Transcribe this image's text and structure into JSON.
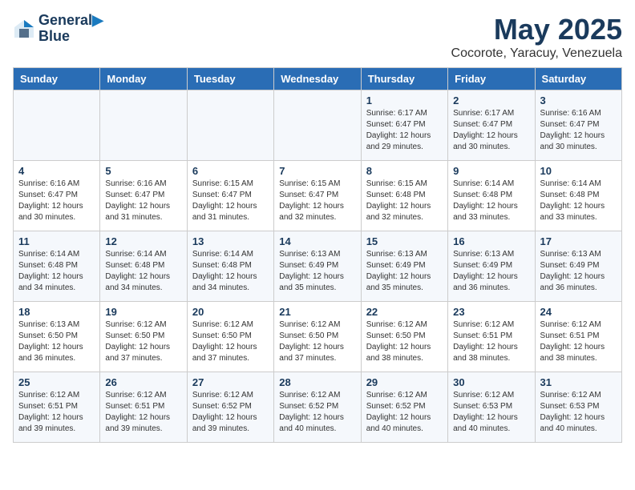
{
  "header": {
    "logo_line1": "General",
    "logo_line2": "Blue",
    "month_year": "May 2025",
    "location": "Cocorote, Yaracuy, Venezuela"
  },
  "days_of_week": [
    "Sunday",
    "Monday",
    "Tuesday",
    "Wednesday",
    "Thursday",
    "Friday",
    "Saturday"
  ],
  "weeks": [
    [
      {
        "day": "",
        "info": ""
      },
      {
        "day": "",
        "info": ""
      },
      {
        "day": "",
        "info": ""
      },
      {
        "day": "",
        "info": ""
      },
      {
        "day": "1",
        "info": "Sunrise: 6:17 AM\nSunset: 6:47 PM\nDaylight: 12 hours\nand 29 minutes."
      },
      {
        "day": "2",
        "info": "Sunrise: 6:17 AM\nSunset: 6:47 PM\nDaylight: 12 hours\nand 30 minutes."
      },
      {
        "day": "3",
        "info": "Sunrise: 6:16 AM\nSunset: 6:47 PM\nDaylight: 12 hours\nand 30 minutes."
      }
    ],
    [
      {
        "day": "4",
        "info": "Sunrise: 6:16 AM\nSunset: 6:47 PM\nDaylight: 12 hours\nand 30 minutes."
      },
      {
        "day": "5",
        "info": "Sunrise: 6:16 AM\nSunset: 6:47 PM\nDaylight: 12 hours\nand 31 minutes."
      },
      {
        "day": "6",
        "info": "Sunrise: 6:15 AM\nSunset: 6:47 PM\nDaylight: 12 hours\nand 31 minutes."
      },
      {
        "day": "7",
        "info": "Sunrise: 6:15 AM\nSunset: 6:47 PM\nDaylight: 12 hours\nand 32 minutes."
      },
      {
        "day": "8",
        "info": "Sunrise: 6:15 AM\nSunset: 6:48 PM\nDaylight: 12 hours\nand 32 minutes."
      },
      {
        "day": "9",
        "info": "Sunrise: 6:14 AM\nSunset: 6:48 PM\nDaylight: 12 hours\nand 33 minutes."
      },
      {
        "day": "10",
        "info": "Sunrise: 6:14 AM\nSunset: 6:48 PM\nDaylight: 12 hours\nand 33 minutes."
      }
    ],
    [
      {
        "day": "11",
        "info": "Sunrise: 6:14 AM\nSunset: 6:48 PM\nDaylight: 12 hours\nand 34 minutes."
      },
      {
        "day": "12",
        "info": "Sunrise: 6:14 AM\nSunset: 6:48 PM\nDaylight: 12 hours\nand 34 minutes."
      },
      {
        "day": "13",
        "info": "Sunrise: 6:14 AM\nSunset: 6:48 PM\nDaylight: 12 hours\nand 34 minutes."
      },
      {
        "day": "14",
        "info": "Sunrise: 6:13 AM\nSunset: 6:49 PM\nDaylight: 12 hours\nand 35 minutes."
      },
      {
        "day": "15",
        "info": "Sunrise: 6:13 AM\nSunset: 6:49 PM\nDaylight: 12 hours\nand 35 minutes."
      },
      {
        "day": "16",
        "info": "Sunrise: 6:13 AM\nSunset: 6:49 PM\nDaylight: 12 hours\nand 36 minutes."
      },
      {
        "day": "17",
        "info": "Sunrise: 6:13 AM\nSunset: 6:49 PM\nDaylight: 12 hours\nand 36 minutes."
      }
    ],
    [
      {
        "day": "18",
        "info": "Sunrise: 6:13 AM\nSunset: 6:50 PM\nDaylight: 12 hours\nand 36 minutes."
      },
      {
        "day": "19",
        "info": "Sunrise: 6:12 AM\nSunset: 6:50 PM\nDaylight: 12 hours\nand 37 minutes."
      },
      {
        "day": "20",
        "info": "Sunrise: 6:12 AM\nSunset: 6:50 PM\nDaylight: 12 hours\nand 37 minutes."
      },
      {
        "day": "21",
        "info": "Sunrise: 6:12 AM\nSunset: 6:50 PM\nDaylight: 12 hours\nand 37 minutes."
      },
      {
        "day": "22",
        "info": "Sunrise: 6:12 AM\nSunset: 6:50 PM\nDaylight: 12 hours\nand 38 minutes."
      },
      {
        "day": "23",
        "info": "Sunrise: 6:12 AM\nSunset: 6:51 PM\nDaylight: 12 hours\nand 38 minutes."
      },
      {
        "day": "24",
        "info": "Sunrise: 6:12 AM\nSunset: 6:51 PM\nDaylight: 12 hours\nand 38 minutes."
      }
    ],
    [
      {
        "day": "25",
        "info": "Sunrise: 6:12 AM\nSunset: 6:51 PM\nDaylight: 12 hours\nand 39 minutes."
      },
      {
        "day": "26",
        "info": "Sunrise: 6:12 AM\nSunset: 6:51 PM\nDaylight: 12 hours\nand 39 minutes."
      },
      {
        "day": "27",
        "info": "Sunrise: 6:12 AM\nSunset: 6:52 PM\nDaylight: 12 hours\nand 39 minutes."
      },
      {
        "day": "28",
        "info": "Sunrise: 6:12 AM\nSunset: 6:52 PM\nDaylight: 12 hours\nand 40 minutes."
      },
      {
        "day": "29",
        "info": "Sunrise: 6:12 AM\nSunset: 6:52 PM\nDaylight: 12 hours\nand 40 minutes."
      },
      {
        "day": "30",
        "info": "Sunrise: 6:12 AM\nSunset: 6:53 PM\nDaylight: 12 hours\nand 40 minutes."
      },
      {
        "day": "31",
        "info": "Sunrise: 6:12 AM\nSunset: 6:53 PM\nDaylight: 12 hours\nand 40 minutes."
      }
    ]
  ]
}
